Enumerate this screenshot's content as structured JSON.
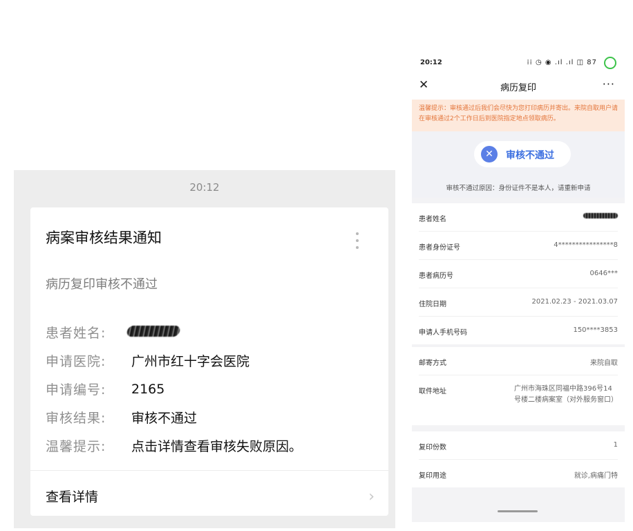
{
  "wechat_message": {
    "time": "20:12",
    "title": "病案审核结果通知",
    "subtitle": "病历复印审核不通过",
    "fields": [
      {
        "label": "患者姓名:",
        "value": ""
      },
      {
        "label": "申请医院:",
        "value": "广州市红十字会医院"
      },
      {
        "label": "申请编号:",
        "value": "2165"
      },
      {
        "label": "审核结果:",
        "value": "审核不通过"
      },
      {
        "label": "温馨提示:",
        "value": "点击详情查看审核失败原因。"
      }
    ],
    "detail_link": "查看详情",
    "arrow": "›"
  },
  "phone": {
    "status_bar": {
      "time": "20:12",
      "icons": "⁞⁞ ◷ ◉ .ıl .ıl ◫ 87"
    },
    "nav": {
      "close": "✕",
      "title": "病历复印",
      "more": "···"
    },
    "notice": "温馨提示：审核通过后我们会尽快为您打印病历并寄出。来院自取用户请在审核通过2个工作日后到医院指定地点领取病历。",
    "status": {
      "icon": "✕",
      "text": "审核不通过",
      "reason": "审核不通过原因：身份证件不是本人，请重新申请"
    },
    "section1": [
      {
        "label": "患者姓名",
        "value": ""
      },
      {
        "label": "患者身份证号",
        "value": "4****************8"
      },
      {
        "label": "患者病历号",
        "value": "0646***"
      },
      {
        "label": "住院日期",
        "value": "2021.02.23 - 2021.03.07"
      },
      {
        "label": "申请人手机号码",
        "value": "150****3853"
      }
    ],
    "section2": [
      {
        "label": "邮寄方式",
        "value": "来院自取"
      },
      {
        "label": "取件地址",
        "value": "广州市海珠区同福中路396号14号楼二楼病案室（对外服务窗口）"
      }
    ],
    "section3": [
      {
        "label": "复印份数",
        "value": "1"
      },
      {
        "label": "复印用途",
        "value": "就诊,病痛门特"
      }
    ]
  }
}
